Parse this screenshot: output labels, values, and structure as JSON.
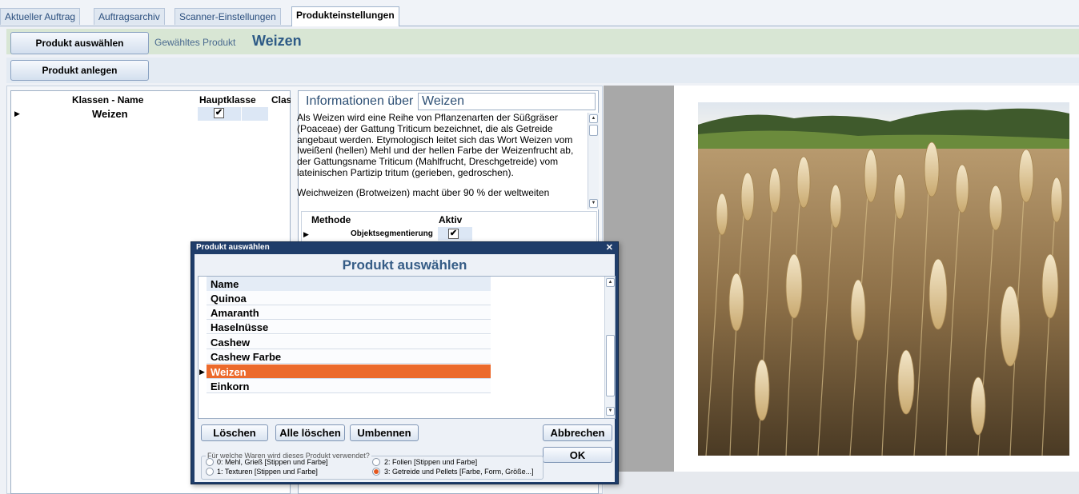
{
  "tabs": [
    {
      "label": "Aktueller Auftrag",
      "active": false
    },
    {
      "label": "Auftragsarchiv",
      "active": false
    },
    {
      "label": "Scanner-Einstellungen",
      "active": false
    },
    {
      "label": "Produkteinstellungen",
      "active": true
    }
  ],
  "toolbar": {
    "select_product_label": "Produkt auswählen",
    "selected_product_caption": "Gewähltes Produkt",
    "selected_product_value": "Weizen",
    "create_product_label": "Produkt anlegen"
  },
  "classes_grid": {
    "columns": [
      "Klassen - Name",
      "Hauptklasse",
      "Class"
    ],
    "rows": [
      {
        "name": "Weizen",
        "hauptklasse": true
      }
    ]
  },
  "info": {
    "title": "Informationen über",
    "product": "Weizen",
    "paragraphs": [
      "Als Weizen wird eine Reihe von Pflanzenarten der Süßgräser (Poaceae) der Gattung Triticum bezeichnet, die als Getreide angebaut werden. Etymologisch leitet sich das Wort Weizen vom Iweißenl (hellen) Mehl und der hellen Farbe der Weizenfrucht ab, der Gattungsname Triticum (Mahlfrucht, Dreschgetreide) vom lateinischen Partizip tritum (gerieben, gedroschen).",
      "Weichweizen (Brotweizen) macht über 90 % der weltweiten"
    ]
  },
  "methods_grid": {
    "columns": [
      "Methode",
      "Aktiv"
    ],
    "rows": [
      {
        "method": "Objektsegmentierung",
        "active": true
      }
    ]
  },
  "dialog": {
    "window_title": "Produkt auswählen",
    "heading": "Produkt auswählen",
    "list_header": "Name",
    "items": [
      "Quinoa",
      "Amaranth",
      "Haselnüsse",
      "Cashew",
      "Cashew Farbe",
      "Weizen",
      "Einkorn"
    ],
    "selected_item": "Weizen",
    "buttons": {
      "delete": "Löschen",
      "delete_all": "Alle löschen",
      "rename": "Umbennen",
      "cancel": "Abbrechen",
      "ok": "OK"
    },
    "usage_group": {
      "title": "Für welche Waren wird dieses Produkt verwendet?",
      "options": [
        {
          "label": "0: Mehl, Grieß [Stippen und Farbe]",
          "checked": false
        },
        {
          "label": "1: Texturen [Stippen und Farbe]",
          "checked": false
        },
        {
          "label": "2: Folien [Stippen und Farbe]",
          "checked": false
        },
        {
          "label": "3: Getreide und Pellets [Farbe, Form, Größe...]",
          "checked": true
        }
      ]
    }
  },
  "colors": {
    "selected_row": "#ec6a2c",
    "dialog_frame": "#1f3d6a",
    "selected_product_bar": "#d8e6d4"
  }
}
